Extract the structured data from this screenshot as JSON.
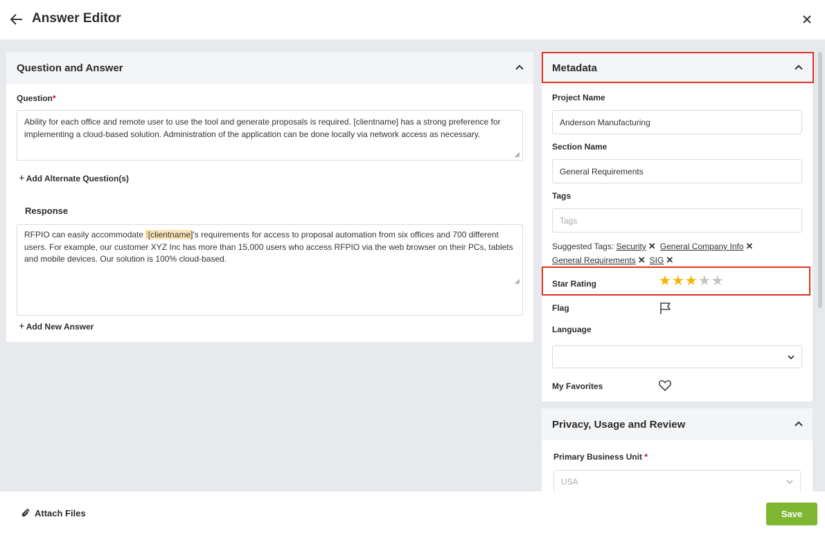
{
  "header": {
    "title": "Answer Editor"
  },
  "qa_card": {
    "title": "Question and Answer",
    "question_label": "Question",
    "required_mark": "*",
    "question_text": "Ability for each office and remote user to use the tool and generate proposals is required.  [clientname] has a strong preference for implementing a cloud-based solution.  Administration of the application can be done locally via network access as necessary.",
    "add_alternate": "Add Alternate Question(s)",
    "response_label": "Response",
    "response_before": "RFPIO can easily accommodate ",
    "response_token": "[clientname]",
    "response_after": "'s requirements for access to proposal automation from six offices and 700 different users. For example, our customer XYZ Inc has more than 15,000 users who access RFPIO via the web browser on their PCs, tablets and mobile devices.  Our solution is 100% cloud-based.",
    "add_answer": "Add New Answer"
  },
  "metadata": {
    "title": "Metadata",
    "project_name_label": "Project Name",
    "project_name": "Anderson Manufacturing",
    "section_name_label": "Section Name",
    "section_name": "General Requirements",
    "tags_label": "Tags",
    "tags_placeholder": "Tags",
    "suggested_label": "Suggested Tags:",
    "suggested_tags": [
      "Security",
      "General Company Info",
      "General Requirements",
      "SIG"
    ],
    "star_rating_label": "Star Rating",
    "star_rating": 3,
    "star_max": 5,
    "flag_label": "Flag",
    "language_label": "Language",
    "language_value": "",
    "favorites_label": "My Favorites"
  },
  "privacy": {
    "title": "Privacy, Usage and Review",
    "business_unit_label": "Primary Business Unit",
    "business_unit_value": "USA"
  },
  "footer": {
    "attach_label": "Attach Files",
    "save_label": "Save"
  },
  "colors": {
    "accent_green": "#7fb733",
    "star": "#f5b301",
    "highlight_red": "#e0321f"
  }
}
